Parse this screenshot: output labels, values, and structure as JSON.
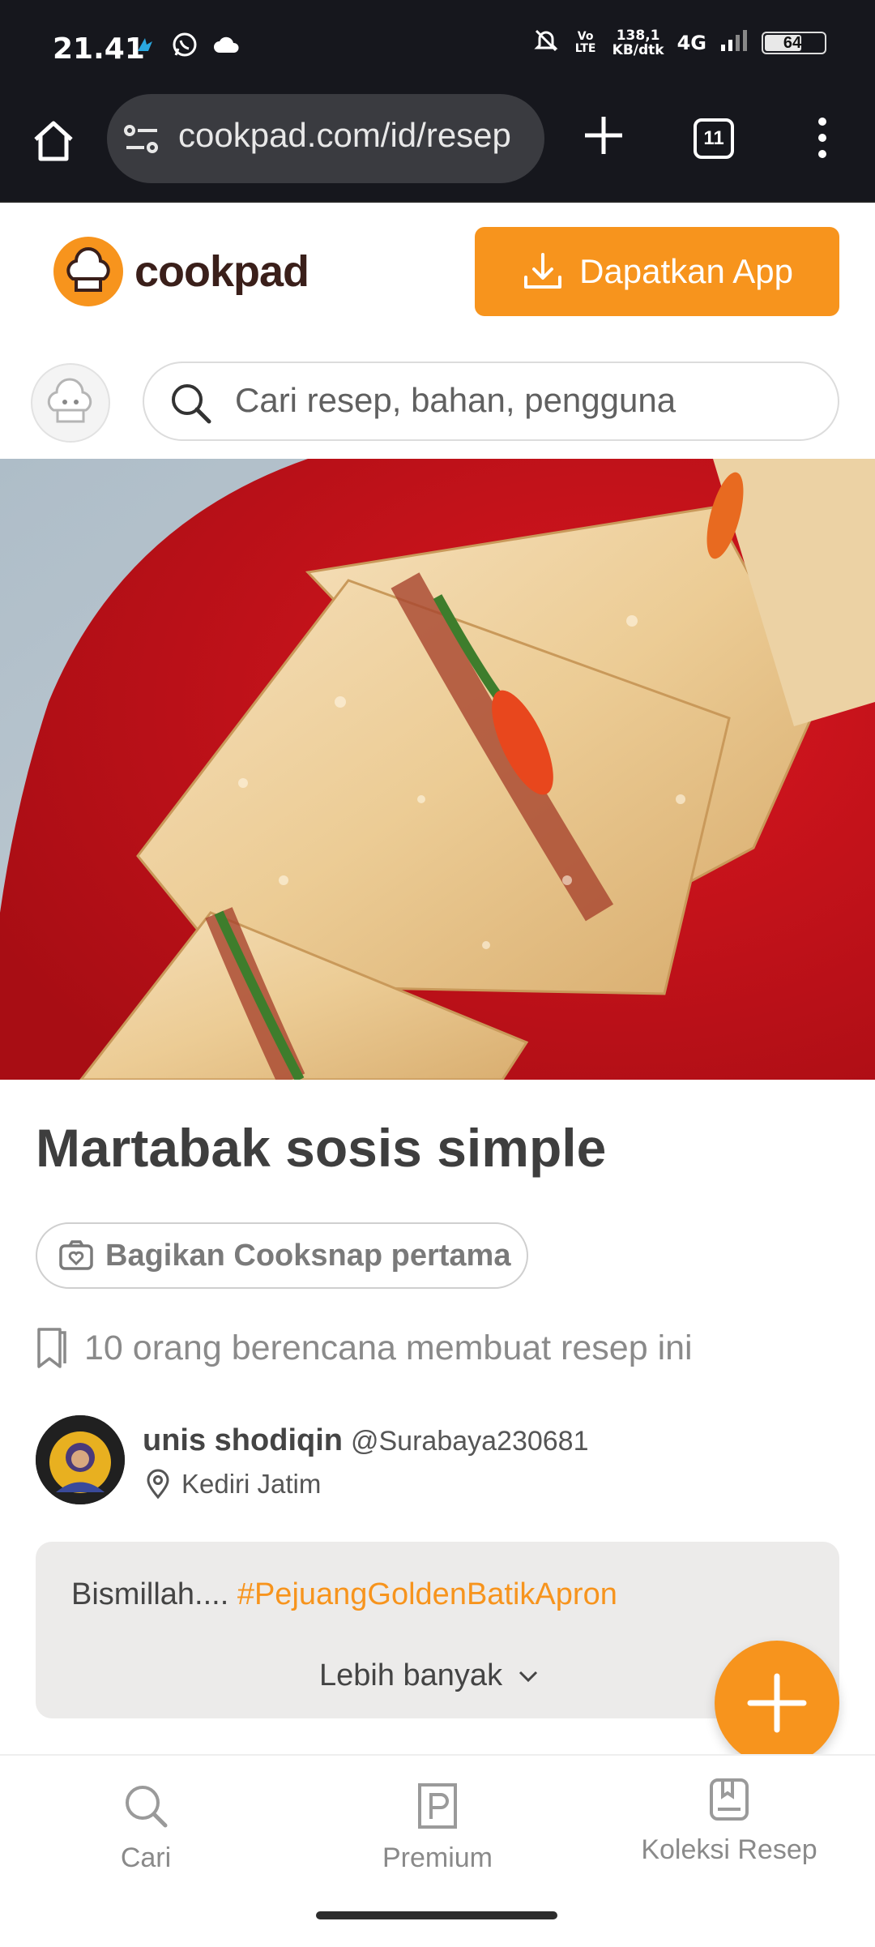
{
  "status_bar": {
    "time": "21.41",
    "net_speed_value": "138,1",
    "net_speed_unit": "KB/dtk",
    "volte": "Vo LTE",
    "network": "4G",
    "battery": "64",
    "battery_level_percent": 64
  },
  "browser": {
    "url": "cookpad.com/id/resep",
    "tab_count": "11"
  },
  "header": {
    "logo_text": "cookpad",
    "get_app_label": "Dapatkan App",
    "search_placeholder": "Cari resep, bahan, pengguna"
  },
  "recipe": {
    "title": "Martabak sosis simple",
    "cooksnap_label": "Bagikan Cooksnap pertama",
    "planning_text": "10 orang berencana membuat resep ini"
  },
  "author": {
    "name": "unis shodiqin",
    "handle": "@Surabaya230681",
    "location": "Kediri Jatim"
  },
  "story": {
    "text": "Bismillah.... ",
    "tag": "#PejuangGoldenBatikApron",
    "more_label": "Lebih banyak"
  },
  "bottom_nav": {
    "items": [
      {
        "label": "Cari",
        "icon": "search-icon"
      },
      {
        "label": "Premium",
        "icon": "premium-icon"
      },
      {
        "label": "Koleksi Resep",
        "icon": "collection-icon"
      }
    ]
  },
  "colors": {
    "accent": "#f7941d",
    "status_bar_bg": "#16171d",
    "title_text": "#3e3e3e"
  }
}
